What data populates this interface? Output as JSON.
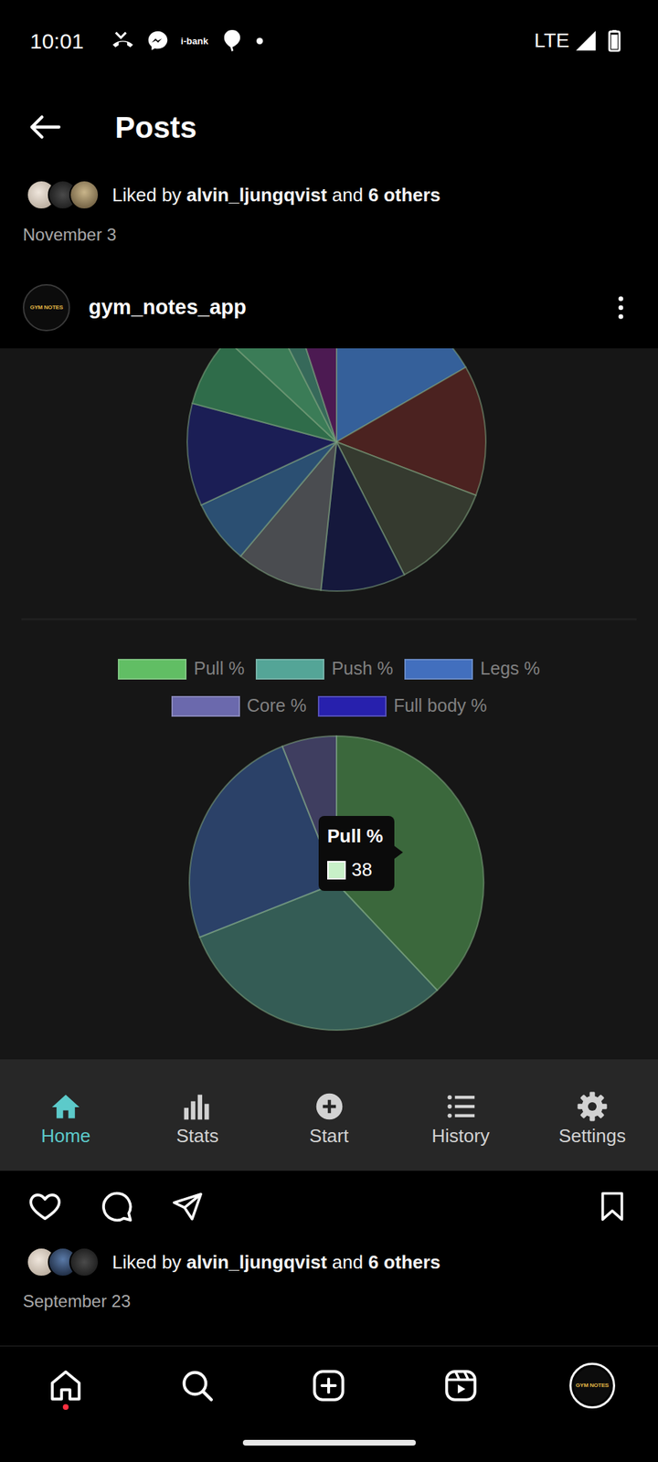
{
  "status_bar": {
    "time": "10:01",
    "bank_app_label": "i-bank",
    "network": "LTE"
  },
  "header": {
    "title": "Posts"
  },
  "previous_post": {
    "likes": {
      "prefix": "Liked by ",
      "user": "alvin_ljungqvist",
      "middle": " and ",
      "others": "6 others"
    },
    "date": "November 3"
  },
  "post": {
    "username": "gym_notes_app",
    "logo_text": "GYM NOTES",
    "screenshot": {
      "top_chart": {
        "slices": [
          {
            "value": 60,
            "color": "#35609a"
          },
          {
            "value": 51,
            "color": "#4b2220"
          },
          {
            "value": 42,
            "color": "#353a2f"
          },
          {
            "value": 33,
            "color": "#15183c"
          },
          {
            "value": 34,
            "color": "#4a4c50"
          },
          {
            "value": 25,
            "color": "#2b4f72"
          },
          {
            "value": 40,
            "color": "#1b1e55"
          },
          {
            "value": 28,
            "color": "#2f6c4a"
          },
          {
            "value": 20,
            "color": "#3b7c57"
          },
          {
            "value": 9,
            "color": "#36695a"
          },
          {
            "value": 18,
            "color": "#4c1a52"
          }
        ]
      },
      "pie_chart": {
        "series": [
          {
            "label": "Pull %",
            "value": 38,
            "color": "#6fdc72"
          },
          {
            "label": "Push %",
            "value": 31,
            "color": "#5fbfae"
          },
          {
            "label": "Legs %",
            "value": 25,
            "color": "#4a7fdc"
          },
          {
            "label": "Core %",
            "value": 6,
            "color": "#7a78c8"
          },
          {
            "label": "Full body %",
            "value": 0,
            "color": "#2a22c8"
          }
        ],
        "tooltip": {
          "label": "Pull %",
          "value": "38",
          "color": "#c8f0c8"
        }
      },
      "nav": [
        {
          "kind": "home",
          "label": "Home",
          "selected": true
        },
        {
          "kind": "stats",
          "label": "Stats",
          "selected": false
        },
        {
          "kind": "start",
          "label": "Start",
          "selected": false
        },
        {
          "kind": "history",
          "label": "History",
          "selected": false
        },
        {
          "kind": "settings",
          "label": "Settings",
          "selected": false
        }
      ]
    },
    "liked": false,
    "saved": false,
    "likes": {
      "prefix": "Liked by ",
      "user": "alvin_ljungqvist",
      "middle": " and ",
      "others": "6 others"
    },
    "date": "September 23"
  },
  "bottom_nav": {
    "profile_logo_text": "GYM NOTES",
    "items": [
      {
        "kind": "home",
        "dot": true
      },
      {
        "kind": "search",
        "dot": false
      },
      {
        "kind": "create",
        "dot": false
      },
      {
        "kind": "reels",
        "dot": false
      },
      {
        "kind": "profile",
        "dot": false
      }
    ]
  }
}
